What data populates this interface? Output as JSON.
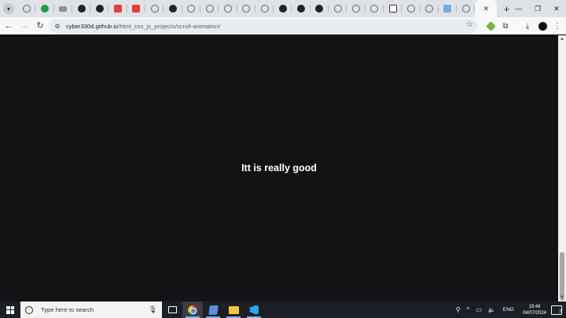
{
  "browser": {
    "tabs": [
      {
        "icon": "globe"
      },
      {
        "icon": "whatsapp"
      },
      {
        "icon": "youtube"
      },
      {
        "icon": "github"
      },
      {
        "icon": "github"
      },
      {
        "icon": "figma"
      },
      {
        "icon": "figma"
      },
      {
        "icon": "globe"
      },
      {
        "icon": "github"
      },
      {
        "icon": "globe"
      },
      {
        "icon": "globe"
      },
      {
        "icon": "globe"
      },
      {
        "icon": "globe"
      },
      {
        "icon": "globe"
      },
      {
        "icon": "github"
      },
      {
        "icon": "github"
      },
      {
        "icon": "github"
      },
      {
        "icon": "globe"
      },
      {
        "icon": "globe"
      },
      {
        "icon": "globe"
      },
      {
        "icon": "app"
      },
      {
        "icon": "globe"
      },
      {
        "icon": "globe"
      },
      {
        "icon": "bluetab"
      },
      {
        "icon": "globe"
      }
    ],
    "active_tab_close": "✕",
    "new_tab": "+",
    "window": {
      "minimize": "—",
      "restore": "❐",
      "close": "✕"
    },
    "address": {
      "host": "cyber330d.github.io",
      "path": "/html_css_js_projects/scroll-animation/"
    }
  },
  "page": {
    "headline": "Itt is really good",
    "background_color": "#131316",
    "text_color": "#ffffff"
  },
  "taskbar": {
    "search_placeholder": "Type here to search",
    "language": "ENG",
    "time": "19:46",
    "date": "04/07/2024",
    "notification_count": "2",
    "pinned": [
      "task-view",
      "chrome",
      "app",
      "file-explorer",
      "vscode"
    ]
  }
}
